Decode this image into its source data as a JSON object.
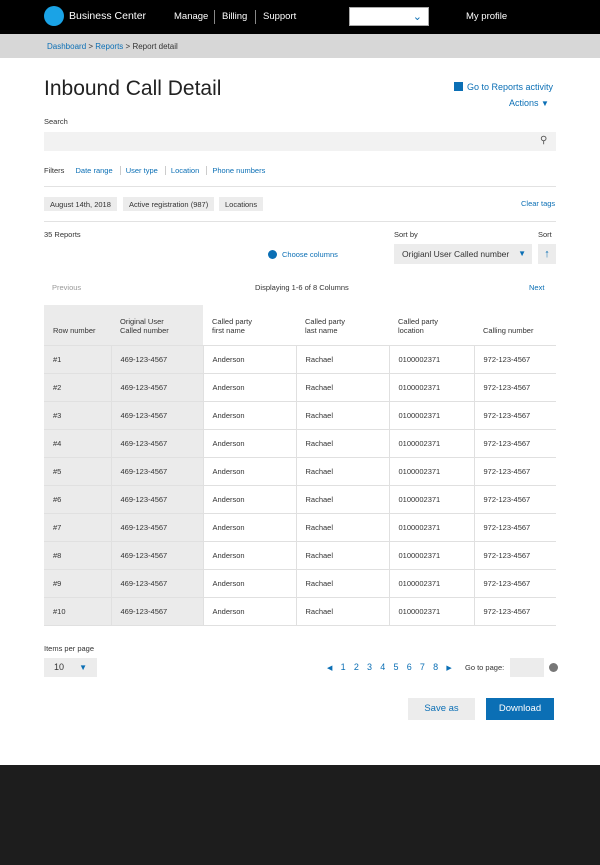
{
  "header": {
    "brand": "Business Center",
    "nav": [
      "Manage",
      "Billing",
      "Support"
    ],
    "select_value": "",
    "profile": "My profile"
  },
  "breadcrumb": {
    "items": [
      "Dashboard",
      "Reports"
    ],
    "current": "Report detail",
    "sep": ">"
  },
  "page": {
    "title": "Inbound Call Detail",
    "reports_link": "Go to Reports activity",
    "actions": "Actions"
  },
  "search": {
    "label": "Search",
    "value": "",
    "placeholder": ""
  },
  "filters": {
    "label": "Filters",
    "items": [
      "Date range",
      "User type",
      "Location",
      "Phone numbers"
    ]
  },
  "tags": {
    "items": [
      "August 14th, 2018",
      "Active registration (987)",
      "Locations"
    ],
    "clear": "Clear tags"
  },
  "controls": {
    "count": "35 Reports",
    "choose_columns": "Choose columns",
    "sort_by_label": "Sort by",
    "sort_by_value": "Origianl User Called number",
    "sort_label": "Sort"
  },
  "table_nav": {
    "previous": "Previous",
    "displaying": "Displaying 1-6 of 8 Columns",
    "next": "Next"
  },
  "table": {
    "headers": [
      [
        "Row number"
      ],
      [
        "Original User",
        "Called number"
      ],
      [
        "Called party",
        "first name"
      ],
      [
        "Called party",
        "last name"
      ],
      [
        "Called party",
        "location"
      ],
      [
        "Calling number"
      ]
    ],
    "rows": [
      [
        "#1",
        "469-123-4567",
        "Anderson",
        "Rachael",
        "0100002371",
        "972-123-4567"
      ],
      [
        "#2",
        "469-123-4567",
        "Anderson",
        "Rachael",
        "0100002371",
        "972-123-4567"
      ],
      [
        "#3",
        "469-123-4567",
        "Anderson",
        "Rachael",
        "0100002371",
        "972-123-4567"
      ],
      [
        "#4",
        "469-123-4567",
        "Anderson",
        "Rachael",
        "0100002371",
        "972-123-4567"
      ],
      [
        "#5",
        "469-123-4567",
        "Anderson",
        "Rachael",
        "0100002371",
        "972-123-4567"
      ],
      [
        "#6",
        "469-123-4567",
        "Anderson",
        "Rachael",
        "0100002371",
        "972-123-4567"
      ],
      [
        "#7",
        "469-123-4567",
        "Anderson",
        "Rachael",
        "0100002371",
        "972-123-4567"
      ],
      [
        "#8",
        "469-123-4567",
        "Anderson",
        "Rachael",
        "0100002371",
        "972-123-4567"
      ],
      [
        "#9",
        "469-123-4567",
        "Anderson",
        "Rachael",
        "0100002371",
        "972-123-4567"
      ],
      [
        "#10",
        "469-123-4567",
        "Anderson",
        "Rachael",
        "0100002371",
        "972-123-4567"
      ]
    ]
  },
  "pagination": {
    "items_per_page_label": "Items per page",
    "items_per_page_value": "10",
    "pages": [
      "1",
      "2",
      "3",
      "4",
      "5",
      "6",
      "7",
      "8"
    ],
    "goto_label": "Go to page:",
    "goto_value": ""
  },
  "buttons": {
    "save_as": "Save as",
    "download": "Download"
  },
  "colors": {
    "accent": "#0b6fb5",
    "logo": "#1aa3e6",
    "header_bg": "#000000",
    "footer_bg": "#1d1d1d"
  }
}
